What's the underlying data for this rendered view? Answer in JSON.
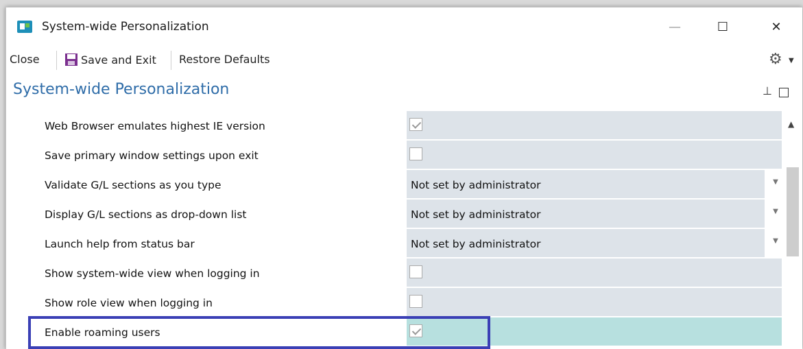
{
  "window": {
    "title": "System-wide Personalization",
    "controls": {
      "minimize": "—",
      "maximize": "☐",
      "close": "✕"
    }
  },
  "toolbar": {
    "close_label": "Close",
    "save_label": "Save and Exit",
    "restore_label": "Restore Defaults"
  },
  "section": {
    "title": "System-wide Personalization"
  },
  "settings": [
    {
      "label": "Web Browser emulates highest IE version",
      "type": "checkbox",
      "checked": true
    },
    {
      "label": "Save primary window settings upon exit",
      "type": "checkbox",
      "checked": false
    },
    {
      "label": "Validate G/L sections as you type",
      "type": "dropdown",
      "value": "Not set by administrator"
    },
    {
      "label": "Display G/L sections as drop-down list",
      "type": "dropdown",
      "value": "Not set by administrator"
    },
    {
      "label": "Launch help from status bar",
      "type": "dropdown",
      "value": "Not set by administrator"
    },
    {
      "label": "Show system-wide view when logging in",
      "type": "checkbox",
      "checked": false
    },
    {
      "label": "Show role view when logging in",
      "type": "checkbox",
      "checked": false
    },
    {
      "label": "Enable roaming users",
      "type": "checkbox",
      "checked": true,
      "selected": true
    }
  ],
  "colors": {
    "accent": "#2e6ca8",
    "highlight_border": "#3a3fb5",
    "value_bg": "#dde3e9",
    "selected_bg": "#b7e0df"
  }
}
